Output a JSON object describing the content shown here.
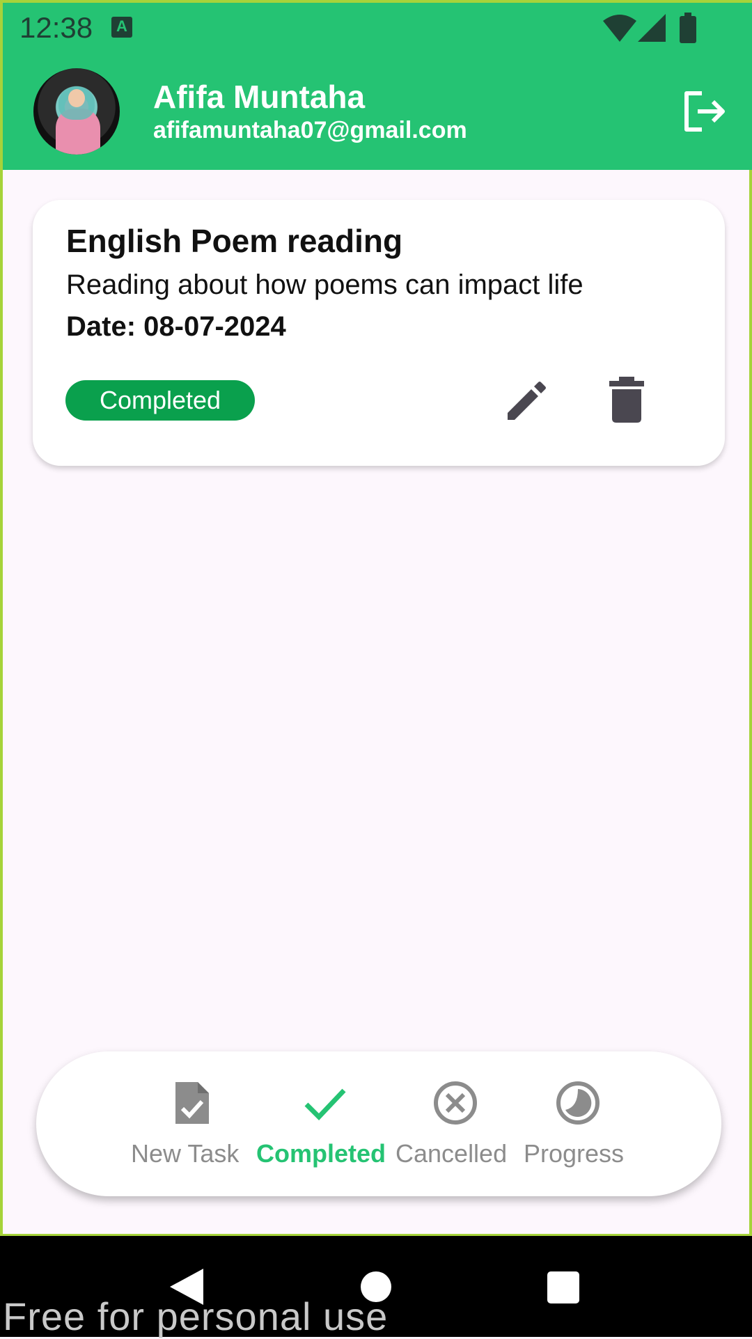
{
  "status_bar": {
    "time": "12:38"
  },
  "header": {
    "user_name": "Afifa Muntaha",
    "user_email": "afifamuntaha07@gmail.com"
  },
  "task": {
    "title": "English Poem reading",
    "description": "Reading about how poems can impact life",
    "date": "Date: 08-07-2024",
    "status": "Completed"
  },
  "bottom_nav": {
    "items": [
      {
        "label": "New Task",
        "icon": "document-check-icon",
        "active": false
      },
      {
        "label": "Completed",
        "icon": "check-icon",
        "active": true
      },
      {
        "label": "Cancelled",
        "icon": "cancel-circle-icon",
        "active": false
      },
      {
        "label": "Progress",
        "icon": "progress-circle-icon",
        "active": false
      }
    ]
  },
  "watermark": "Free for personal use",
  "colors": {
    "primary": "#25c373",
    "status_chip": "#0aa04d",
    "inactive": "#8c8c8c",
    "icon_dark": "#4a4750"
  }
}
